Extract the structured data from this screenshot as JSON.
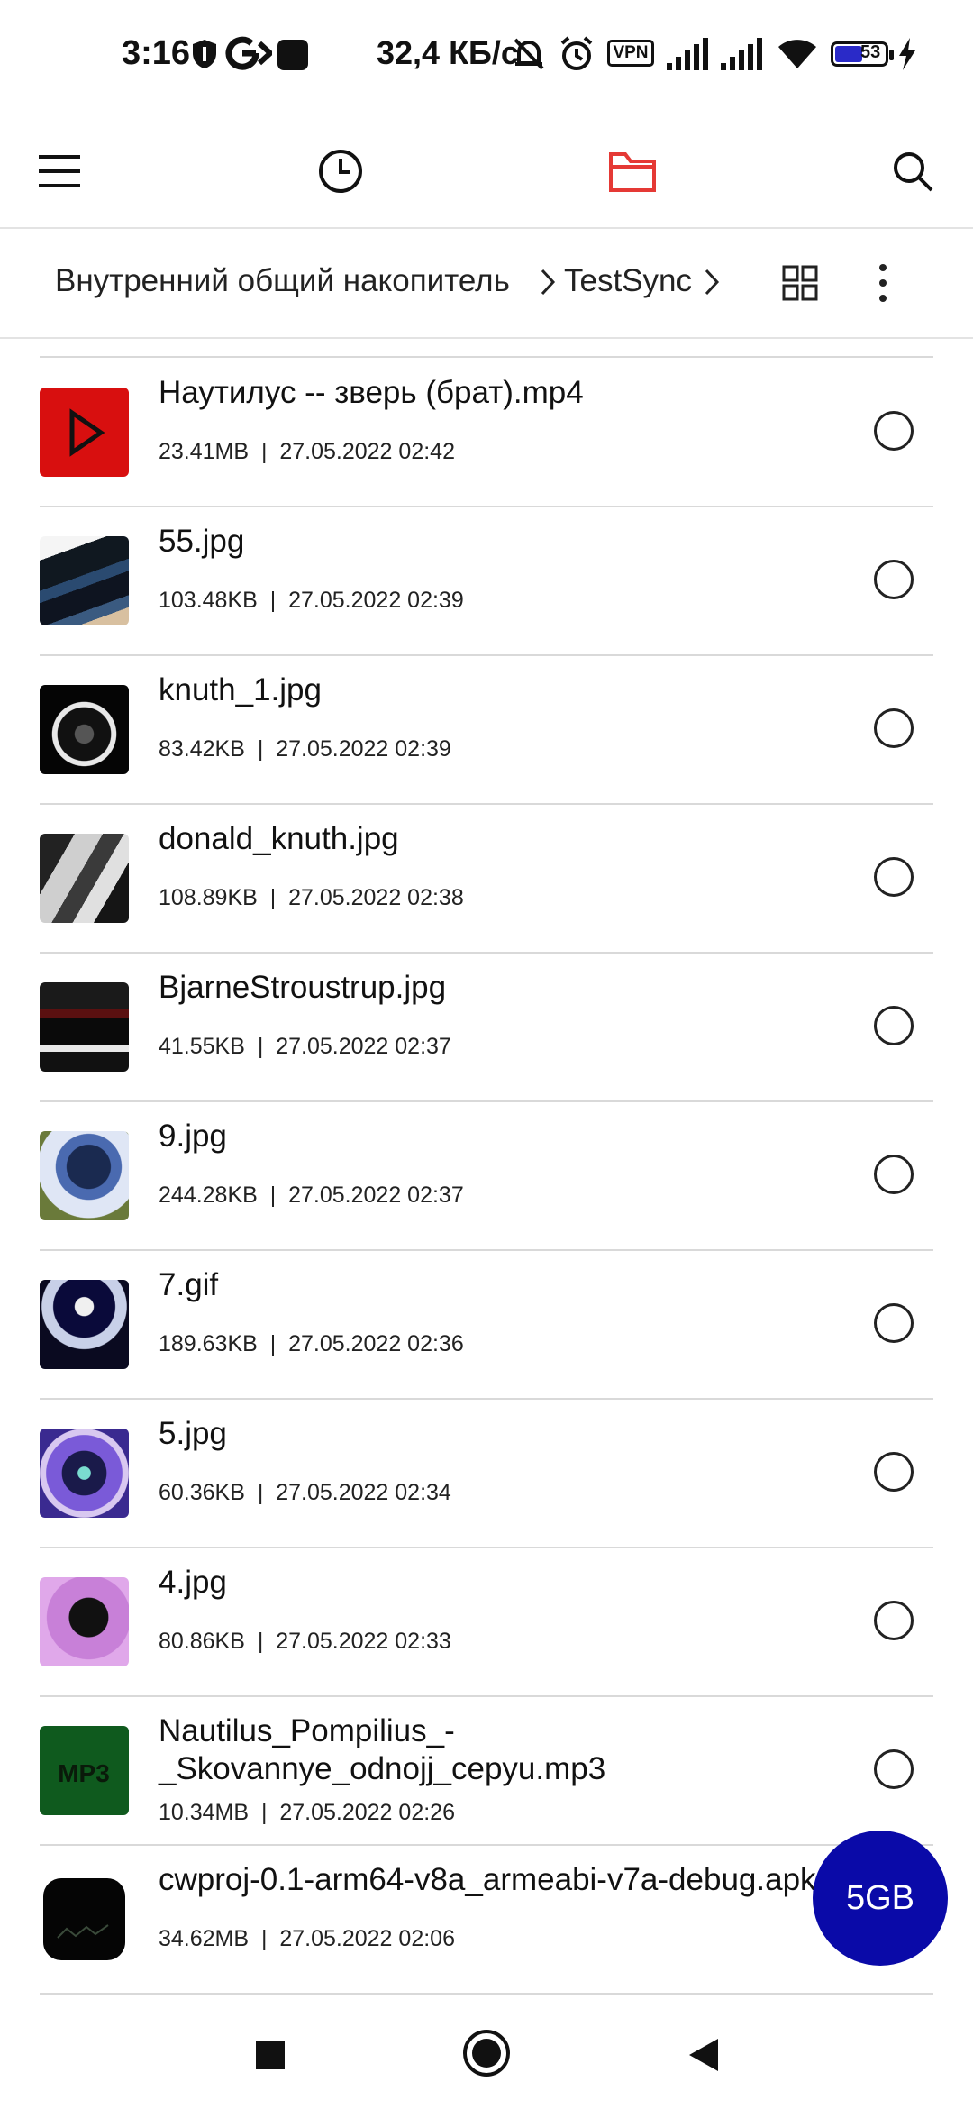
{
  "status_bar": {
    "time": "3:16",
    "speed": "32,4 КБ/с",
    "vpn": "VPN",
    "battery": "53"
  },
  "toolbar": {
    "menu_icon": "hamburger-icon",
    "recent_icon": "clock-icon",
    "files_icon": "folder-icon",
    "search_icon": "search-icon",
    "active_color": "#e53935"
  },
  "breadcrumb": {
    "root": "Внутренний общий накопитель",
    "current": "TestSync"
  },
  "files": [
    {
      "name": "Наутилус -- зверь (брат).mp4",
      "size": "23.41MB",
      "date": "27.05.2022 02:42",
      "thumb": "video"
    },
    {
      "name": "55.jpg",
      "size": "103.48KB",
      "date": "27.05.2022 02:39",
      "thumb": "books"
    },
    {
      "name": "knuth_1.jpg",
      "size": "83.42KB",
      "date": "27.05.2022 02:39",
      "thumb": "portrait-dark"
    },
    {
      "name": "donald_knuth.jpg",
      "size": "108.89KB",
      "date": "27.05.2022 02:38",
      "thumb": "portrait-gray"
    },
    {
      "name": "BjarneStroustrup.jpg",
      "size": "41.55KB",
      "date": "27.05.2022 02:37",
      "thumb": "office"
    },
    {
      "name": "9.jpg",
      "size": "244.28KB",
      "date": "27.05.2022 02:37",
      "thumb": "blue-face"
    },
    {
      "name": "7.gif",
      "size": "189.63KB",
      "date": "27.05.2022 02:36",
      "thumb": "person-blue"
    },
    {
      "name": "5.jpg",
      "size": "60.36KB",
      "date": "27.05.2022 02:34",
      "thumb": "purple-animal"
    },
    {
      "name": "4.jpg",
      "size": "80.86KB",
      "date": "27.05.2022 02:33",
      "thumb": "pink-animal"
    },
    {
      "name": "Nautilus_Pompilius_-_Skovannye_odnojj_cepyu.mp3",
      "size": "10.34MB",
      "date": "27.05.2022 02:26",
      "thumb": "mp3"
    },
    {
      "name": "cwproj-0.1-arm64-v8a_armeabi-v7a-debug.apk",
      "size": "34.62MB",
      "date": "27.05.2022 02:06",
      "thumb": "apk"
    }
  ],
  "fab": {
    "label": "5GB",
    "color": "#0a0aa8"
  },
  "navbar": {
    "recents_icon": "square-icon",
    "home_icon": "circle-icon",
    "back_icon": "triangle-back-icon"
  }
}
